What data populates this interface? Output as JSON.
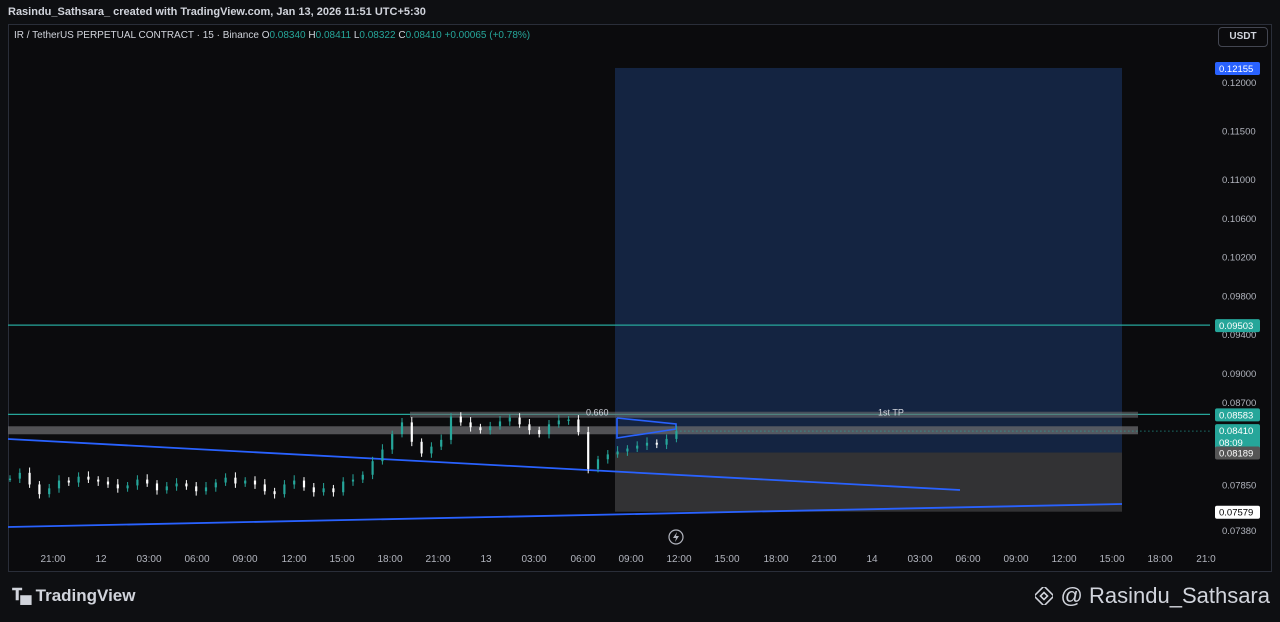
{
  "header": {
    "credit": "Rasindu_Sathsara_ created with TradingView.com, Jan 13, 2026 11:51 UTC+5:30"
  },
  "legend": {
    "symbol": "IR / TetherUS PERPETUAL CONTRACT · 15 · Binance",
    "o_label": "O",
    "o_value": "0.08340",
    "h_label": "H",
    "h_value": "0.08411",
    "l_label": "L",
    "l_value": "0.08322",
    "c_label": "C",
    "c_value": "0.08410",
    "change": "+0.00065 (+0.78%)"
  },
  "currency_button": "USDT",
  "footer": {
    "brand": "TradingView",
    "handle": "@ Rasindu_Sathsara"
  },
  "colors": {
    "up": "#26a69a",
    "down": "#ffffff",
    "trendline": "#2962ff",
    "target_zone": "#1e3a6e",
    "stop_zone": "#3a3a3c",
    "level_line": "#26a69a"
  },
  "chart_data": {
    "type": "candlestick",
    "title": "",
    "xlabel": "",
    "ylabel": "",
    "ylim": [
      0.0729,
      0.1235
    ],
    "y_ticks": [
      "0.12000",
      "0.11500",
      "0.11000",
      "0.10600",
      "0.10200",
      "0.09800",
      "0.09400",
      "0.09000",
      "0.08700",
      "0.08180",
      "0.07850",
      "0.07380"
    ],
    "x_ticks": [
      "21:00",
      "12",
      "03:00",
      "06:00",
      "09:00",
      "12:00",
      "15:00",
      "18:00",
      "21:00",
      "13",
      "03:00",
      "06:00",
      "09:00",
      "12:00",
      "15:00",
      "18:00",
      "21:00",
      "14",
      "03:00",
      "06:00",
      "09:00",
      "12:00",
      "15:00",
      "18:00",
      "21:0"
    ],
    "price_labels": [
      {
        "value": 0.12155,
        "text": "0.12155",
        "color": "#2962ff"
      },
      {
        "value": 0.09503,
        "text": "0.09503",
        "color": "#26a69a"
      },
      {
        "value": 0.08583,
        "text": "0.08583",
        "color": "#26a69a"
      },
      {
        "value": 0.0841,
        "text": "0.08410",
        "sub": "08:09",
        "color": "#26a69a"
      },
      {
        "value": 0.08189,
        "text": "0.08189",
        "color": "#555555"
      },
      {
        "value": 0.07579,
        "text": "0.07579",
        "color": "#ffffff"
      }
    ],
    "annotations": [
      "0.660",
      "1st TP"
    ],
    "position": {
      "entry": 0.08189,
      "target": 0.12155,
      "stop": 0.07579
    },
    "horizontal_levels": [
      0.09503,
      0.08583
    ],
    "close_path": [
      [
        0,
        0.0792
      ],
      [
        4,
        0.0798
      ],
      [
        8,
        0.0786
      ],
      [
        12,
        0.0776
      ],
      [
        16,
        0.0782
      ],
      [
        20,
        0.079
      ],
      [
        24,
        0.0788
      ],
      [
        28,
        0.0794
      ],
      [
        32,
        0.0791
      ],
      [
        36,
        0.0789
      ],
      [
        40,
        0.0786
      ],
      [
        44,
        0.0782
      ],
      [
        48,
        0.0785
      ],
      [
        52,
        0.0791
      ],
      [
        56,
        0.0787
      ],
      [
        60,
        0.078
      ],
      [
        64,
        0.0784
      ],
      [
        68,
        0.0787
      ],
      [
        72,
        0.0784
      ],
      [
        76,
        0.0779
      ],
      [
        80,
        0.0783
      ],
      [
        84,
        0.0788
      ],
      [
        88,
        0.0793
      ],
      [
        92,
        0.0787
      ],
      [
        96,
        0.079
      ],
      [
        100,
        0.0786
      ],
      [
        104,
        0.0779
      ],
      [
        108,
        0.0776
      ],
      [
        112,
        0.0786
      ],
      [
        116,
        0.079
      ],
      [
        120,
        0.0783
      ],
      [
        124,
        0.0778
      ],
      [
        128,
        0.0782
      ],
      [
        132,
        0.0778
      ],
      [
        136,
        0.0789
      ],
      [
        140,
        0.0791
      ],
      [
        144,
        0.0796
      ],
      [
        148,
        0.081
      ],
      [
        152,
        0.0822
      ],
      [
        156,
        0.0838
      ],
      [
        160,
        0.085
      ],
      [
        164,
        0.083
      ],
      [
        168,
        0.0818
      ],
      [
        172,
        0.0825
      ],
      [
        176,
        0.0832
      ],
      [
        180,
        0.0856
      ],
      [
        184,
        0.085
      ],
      [
        188,
        0.0845
      ],
      [
        192,
        0.0842
      ],
      [
        196,
        0.0846
      ],
      [
        200,
        0.0851
      ],
      [
        204,
        0.0855
      ],
      [
        208,
        0.0848
      ],
      [
        212,
        0.0842
      ],
      [
        216,
        0.0838
      ],
      [
        220,
        0.0848
      ],
      [
        224,
        0.0852
      ],
      [
        228,
        0.0853
      ],
      [
        232,
        0.084
      ],
      [
        236,
        0.0802
      ],
      [
        240,
        0.0812
      ],
      [
        244,
        0.0817
      ],
      [
        248,
        0.082
      ],
      [
        252,
        0.0823
      ],
      [
        256,
        0.0826
      ],
      [
        260,
        0.0829
      ],
      [
        264,
        0.0827
      ],
      [
        268,
        0.0833
      ],
      [
        272,
        0.0841
      ]
    ]
  }
}
